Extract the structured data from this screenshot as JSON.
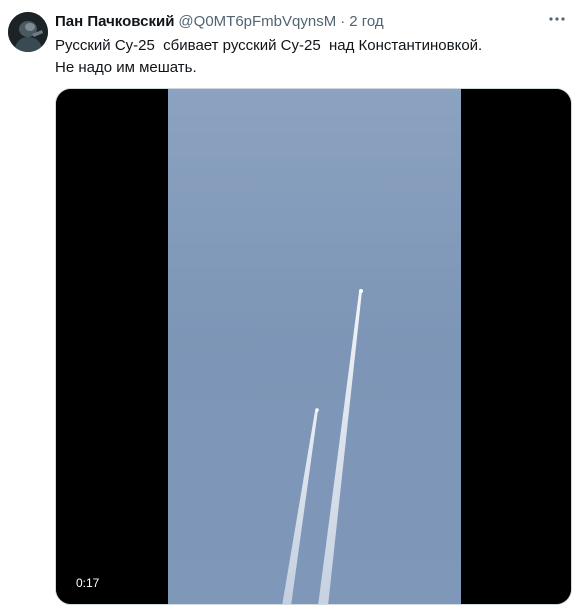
{
  "tweet": {
    "author_name": "Пан Пачковский",
    "handle": "@Q0MT6pFmbVqynsM",
    "separator": "·",
    "time": "2 год",
    "text": "Русский Су-25  сбивает русский Су-25  над Константиновкой.\nНе надо им мешать.",
    "more_icon": "more-horizontal-icon",
    "avatar_icon": "profile-avatar"
  },
  "media": {
    "type": "video",
    "duration": "0:17",
    "sky_color": "#7d95b6",
    "letterbox_color": "#000000"
  }
}
